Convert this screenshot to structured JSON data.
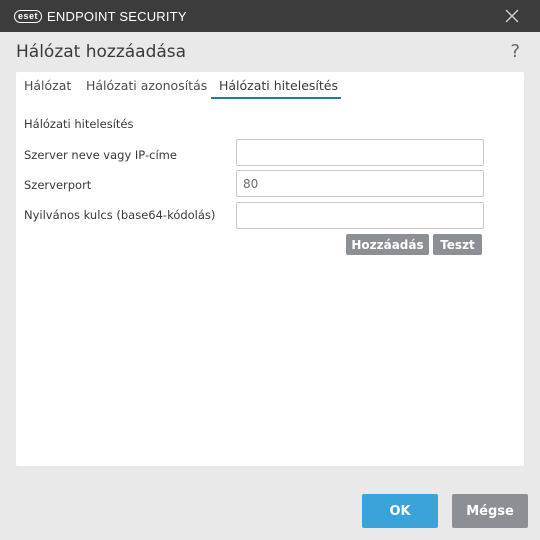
{
  "titlebar": {
    "logo_text": "eset",
    "product": "ENDPOINT SECURITY"
  },
  "dialog": {
    "title": "Hálózat hozzáadása",
    "help": "?"
  },
  "tabs": [
    {
      "label": "Hálózat",
      "active": false
    },
    {
      "label": "Hálózati azonosítás",
      "active": false
    },
    {
      "label": "Hálózati hitelesítés",
      "active": true
    }
  ],
  "section": {
    "title": "Hálózati hitelesítés"
  },
  "fields": [
    {
      "label": "Szerver neve vagy IP-címe",
      "value": "",
      "placeholder": ""
    },
    {
      "label": "Szerverport",
      "value": "80",
      "placeholder": ""
    },
    {
      "label": "Nyilvános kulcs (base64-kódolás)",
      "value": "",
      "placeholder": ""
    }
  ],
  "actions": {
    "add": "Hozzáadás",
    "test": "Teszt"
  },
  "footer": {
    "ok": "OK",
    "cancel": "Mégse"
  },
  "colors": {
    "titlebar": "#3c3c3c",
    "accent": "#3aa3d9",
    "tab_underline": "#1e7a9f",
    "gray_button": "#8c9094"
  },
  "icons": {
    "close": "close-icon",
    "help": "help-icon"
  }
}
